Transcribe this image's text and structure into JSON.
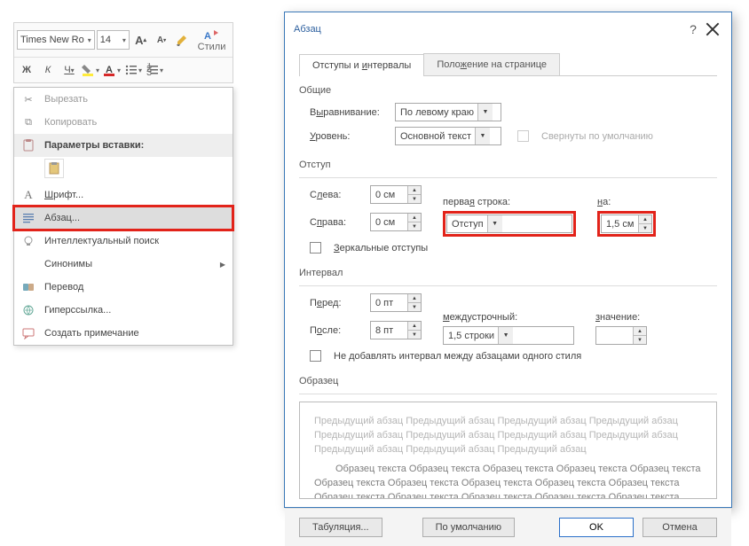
{
  "ribbon": {
    "font_name": "Times New Ro",
    "font_size": "14",
    "bold": "Ж",
    "italic": "К",
    "under": "Ч",
    "styles_label": "Стили"
  },
  "ctx": {
    "cut": "Вырезать",
    "copy": "Копировать",
    "paste_hdr": "Параметры вставки:",
    "font": "Шрифт...",
    "paragraph": "Абзац...",
    "smart": "Интеллектуальный поиск",
    "synonyms": "Синонимы",
    "translate": "Перевод",
    "hyperlink": "Гиперссылка...",
    "comment": "Создать примечание"
  },
  "dlg": {
    "title": "Абзац",
    "tab1": "Отступы и интервалы",
    "tab2": "Положение на странице",
    "grp_general": "Общие",
    "align_lbl": "Выравнивание:",
    "align_val": "По левому краю",
    "level_lbl": "Уровень:",
    "level_val": "Основной текст",
    "collapse": "Свернуты по умолчанию",
    "grp_indent": "Отступ",
    "left_lbl": "Слева:",
    "left_val": "0 см",
    "right_lbl": "Справа:",
    "right_val": "0 см",
    "first_lbl": "первая строка:",
    "first_val": "Отступ",
    "on_lbl": "на:",
    "on_val": "1,5 см",
    "mirror": "Зеркальные отступы",
    "grp_spacing": "Интервал",
    "before_lbl": "Перед:",
    "before_val": "0 пт",
    "after_lbl": "После:",
    "after_val": "8 пт",
    "line_lbl": "междустрочный:",
    "line_val": "1,5 строки",
    "val_lbl": "значение:",
    "val_val": "",
    "nosame": "Не добавлять интервал между абзацами одного стиля",
    "grp_preview": "Образец",
    "preview_prev": "Предыдущий абзац Предыдущий абзац Предыдущий абзац Предыдущий абзац Предыдущий абзац Предыдущий абзац Предыдущий абзац Предыдущий абзац Предыдущий абзац Предыдущий абзац Предыдущий абзац",
    "preview_sample": "Образец текста Образец текста Образец текста Образец текста Образец текста Образец текста Образец текста Образец текста Образец текста Образец текста Образец текста Образец текста Образец текста Образец текста Образец текста",
    "tabs_btn": "Табуляция...",
    "default_btn": "По умолчанию",
    "ok": "OK",
    "cancel": "Отмена"
  }
}
